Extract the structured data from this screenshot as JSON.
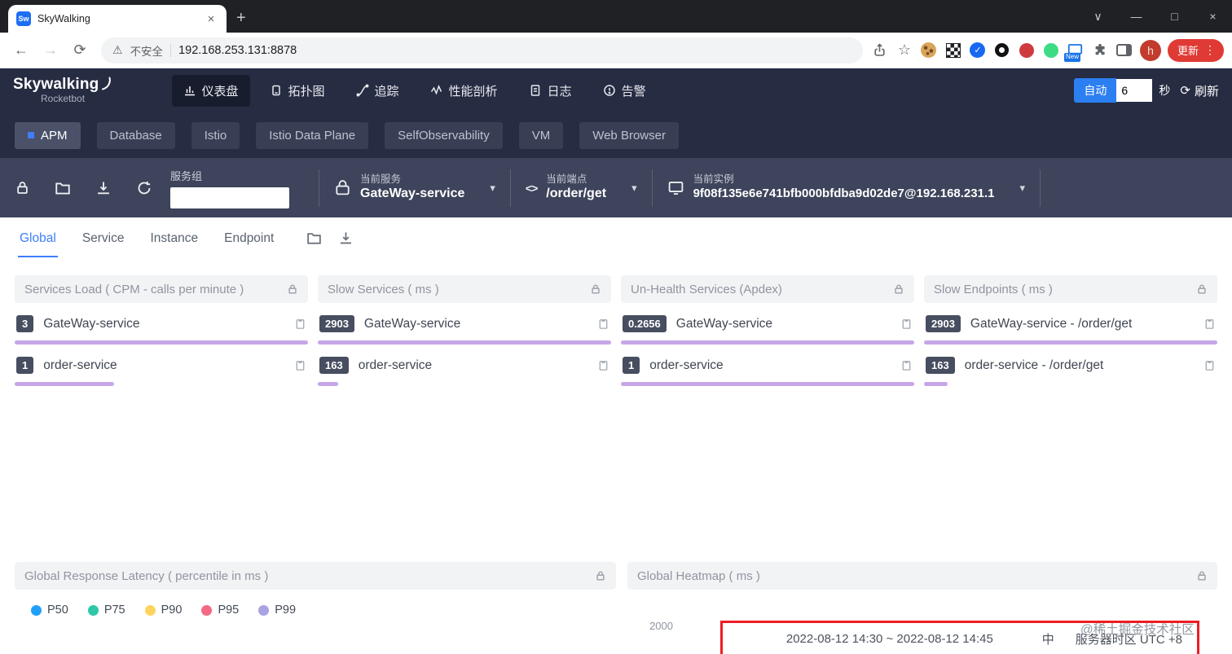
{
  "icons": {
    "back": "←",
    "forward": "→",
    "reload": "⟳",
    "warning": "⚠",
    "star": "☆",
    "new_tab": "+",
    "close": "×",
    "minimize": "—",
    "maximize": "□",
    "window_chevron": "∨",
    "menu_dots": "⋮",
    "caret_down": "▾",
    "check": "✓",
    "code": "<>"
  },
  "browser": {
    "tab_title": "SkyWalking",
    "favicon_text": "Sw",
    "security_label": "不安全",
    "url": "192.168.253.131:8878",
    "new_badge_label": "New",
    "avatar_letter": "h",
    "update_label": "更新"
  },
  "header": {
    "logo": "Skywalking",
    "logo_sub": "Rocketbot",
    "nav": [
      {
        "label": "仪表盘"
      },
      {
        "label": "拓扑图"
      },
      {
        "label": "追踪"
      },
      {
        "label": "性能剖析"
      },
      {
        "label": "日志"
      },
      {
        "label": "告警"
      }
    ],
    "auto_label": "自动",
    "interval_value": "6",
    "interval_unit": "秒",
    "refresh_label": "刷新"
  },
  "subnav": [
    {
      "label": "APM"
    },
    {
      "label": "Database"
    },
    {
      "label": "Istio"
    },
    {
      "label": "Istio Data Plane"
    },
    {
      "label": "SelfObservability"
    },
    {
      "label": "VM"
    },
    {
      "label": "Web Browser"
    }
  ],
  "toolbar": {
    "service_group_label": "服务组",
    "service_group_value": "",
    "service_label": "当前服务",
    "service_value": "GateWay-service",
    "endpoint_label": "当前端点",
    "endpoint_value": "/order/get",
    "instance_label": "当前实例",
    "instance_value": "9f08f135e6e741bfb000bfdba9d02de7@192.168.231.1"
  },
  "view_tabs": [
    {
      "label": "Global"
    },
    {
      "label": "Service"
    },
    {
      "label": "Instance"
    },
    {
      "label": "Endpoint"
    }
  ],
  "cards": [
    {
      "title": "Services Load ( CPM - calls per minute )",
      "rows": [
        {
          "value": "3",
          "name": "GateWay-service",
          "bar_width": "100%"
        },
        {
          "value": "1",
          "name": "order-service",
          "bar_width": "34%"
        }
      ]
    },
    {
      "title": "Slow Services ( ms )",
      "rows": [
        {
          "value": "2903",
          "name": "GateWay-service",
          "bar_width": "100%"
        },
        {
          "value": "163",
          "name": "order-service",
          "bar_width": "7%"
        }
      ]
    },
    {
      "title": "Un-Health Services (Apdex)",
      "rows": [
        {
          "value": "0.2656",
          "name": "GateWay-service",
          "bar_width": "100%"
        },
        {
          "value": "1",
          "name": "order-service",
          "bar_width": "100%"
        }
      ]
    },
    {
      "title": "Slow Endpoints ( ms )",
      "rows": [
        {
          "value": "2903",
          "name": "GateWay-service - /order/get",
          "bar_width": "100%"
        },
        {
          "value": "163",
          "name": "order-service - /order/get",
          "bar_width": "8%"
        }
      ]
    }
  ],
  "latency_card": {
    "title": "Global Response Latency ( percentile in ms )",
    "legend": [
      {
        "label": "P50",
        "color": "#21a0fb"
      },
      {
        "label": "P75",
        "color": "#2fc7a7"
      },
      {
        "label": "P90",
        "color": "#ffd45e"
      },
      {
        "label": "P95",
        "color": "#f56a83"
      },
      {
        "label": "P99",
        "color": "#a8a3e2"
      }
    ]
  },
  "heatmap_card": {
    "title": "Global Heatmap ( ms )",
    "axis_tick": "2000"
  },
  "timebar": {
    "range": "2022-08-12 14:30 ~ 2022-08-12 14:45",
    "lang_label": "中",
    "timezone_label": "服务器时区 UTC +8",
    "highlight_color": "#ee1d24"
  },
  "watermark": "@稀土掘金技术社区",
  "accent": {
    "blue": "#2d7cf6",
    "bar_purple": "#c6a6e8"
  }
}
